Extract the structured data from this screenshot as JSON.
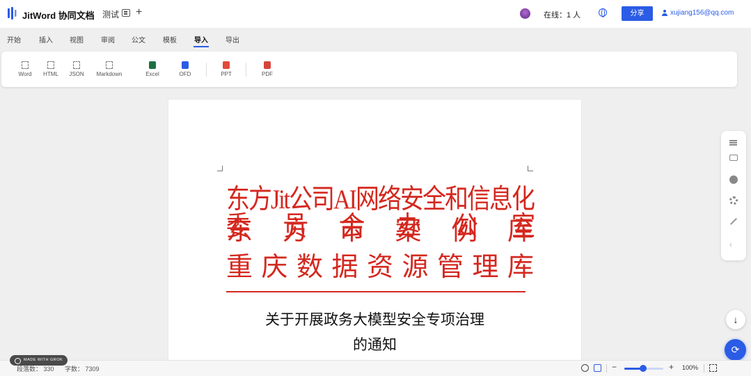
{
  "header": {
    "brand": "JitWord 协同文档",
    "doc_name": "测试",
    "online": "在线：1 人",
    "share_label": "分享",
    "user_email": "xujiang156@qq.com"
  },
  "tabs": [
    {
      "label": "开始"
    },
    {
      "label": "插入"
    },
    {
      "label": "视图"
    },
    {
      "label": "审阅"
    },
    {
      "label": "公文"
    },
    {
      "label": "模板"
    },
    {
      "label": "导入"
    },
    {
      "label": "导出"
    }
  ],
  "active_tab": "导入",
  "ribbon": {
    "items": [
      {
        "label": "Word",
        "icon": "word-import-icon"
      },
      {
        "label": "HTML",
        "icon": "html-import-icon"
      },
      {
        "label": "JSON",
        "icon": "json-import-icon"
      },
      {
        "label": "Markdown",
        "icon": "markdown-import-icon"
      },
      {
        "label": "Excel",
        "icon": "excel-icon"
      },
      {
        "label": "OFD",
        "icon": "ofd-icon"
      },
      {
        "label": "PPT",
        "icon": "ppt-icon"
      },
      {
        "label": "PDF",
        "icon": "pdf-icon"
      }
    ]
  },
  "document": {
    "red_header_lines": [
      "东方Jit公司AI网络安全和信息化委员会办公室",
      "东方市案例库",
      "重庆数据资源管理库"
    ],
    "title_line1": "关于开展政务大模型安全专项治理",
    "title_line2": "的通知"
  },
  "statusbar": {
    "made_with": "MADE WITH GROK",
    "paragraphs": "段落数： 330",
    "words": "字数： 7309",
    "zoom": "100%",
    "zoom_value": 100
  },
  "colors": {
    "accent": "#2b5ce6",
    "red_header": "#d4281f"
  }
}
